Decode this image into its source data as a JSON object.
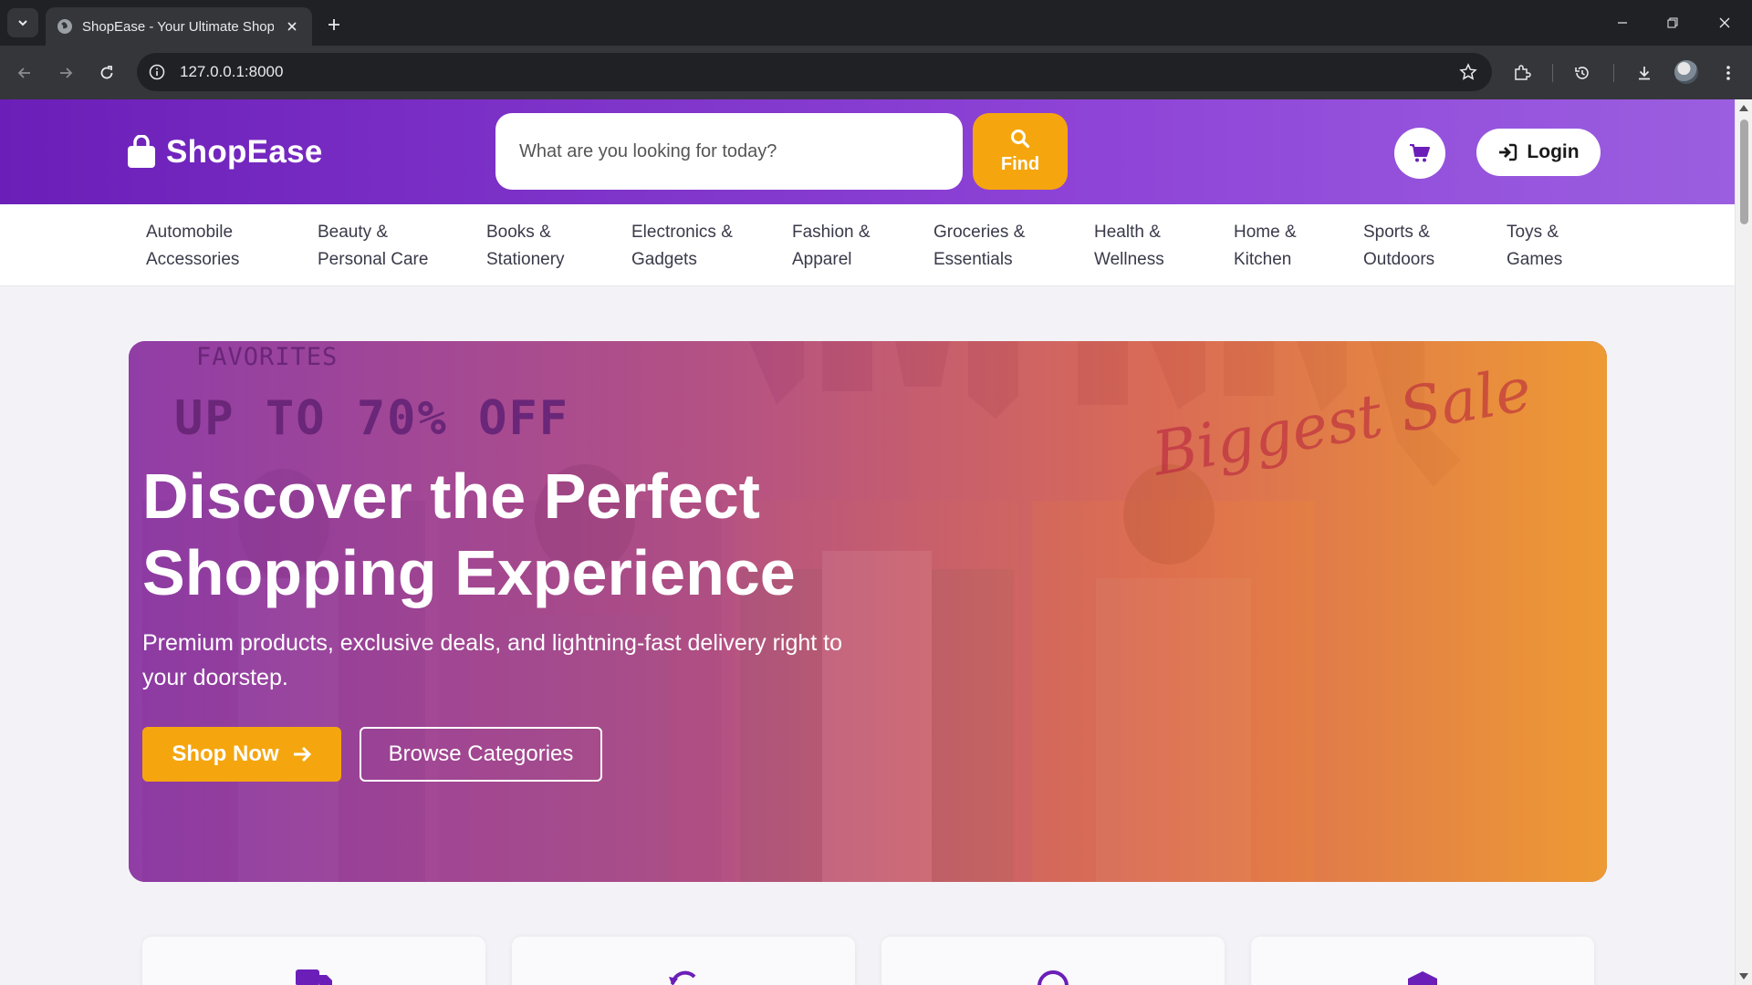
{
  "browser": {
    "tab_title": "ShopEase - Your Ultimate Shopping Destination",
    "url": "127.0.0.1:8000"
  },
  "site": {
    "brand": "ShopEase",
    "search": {
      "placeholder": "What are you looking for today?"
    },
    "find_label": "Find",
    "login_label": "Login",
    "brand_colors": {
      "primary": "#6b1fb8",
      "accent": "#f5a60e"
    }
  },
  "categories": [
    {
      "line1": "Automobile",
      "line2": "Accessories"
    },
    {
      "line1": "Beauty &",
      "line2": "Personal Care"
    },
    {
      "line1": "Books &",
      "line2": "Stationery"
    },
    {
      "line1": "Electronics &",
      "line2": "Gadgets"
    },
    {
      "line1": "Fashion &",
      "line2": "Apparel"
    },
    {
      "line1": "Groceries &",
      "line2": "Essentials"
    },
    {
      "line1": "Health &",
      "line2": "Wellness"
    },
    {
      "line1": "Home &",
      "line2": "Kitchen"
    },
    {
      "line1": "Sports &",
      "line2": "Outdoors"
    },
    {
      "line1": "Toys &",
      "line2": "Games"
    }
  ],
  "hero": {
    "banner_top": "FAVORITES",
    "banner_promo": "UP TO 70% OFF",
    "banner_script": "Biggest Sale",
    "headline_line1": "Discover the Perfect",
    "headline_line2": "Shopping Experience",
    "subhead": "Premium products, exclusive deals, and lightning-fast delivery right to your doorstep.",
    "primary_cta": "Shop Now",
    "secondary_cta": "Browse Categories"
  },
  "feature_cards": [
    {
      "icon": "truck-icon"
    },
    {
      "icon": "return-icon"
    },
    {
      "icon": "headset-icon"
    },
    {
      "icon": "shield-icon"
    }
  ]
}
